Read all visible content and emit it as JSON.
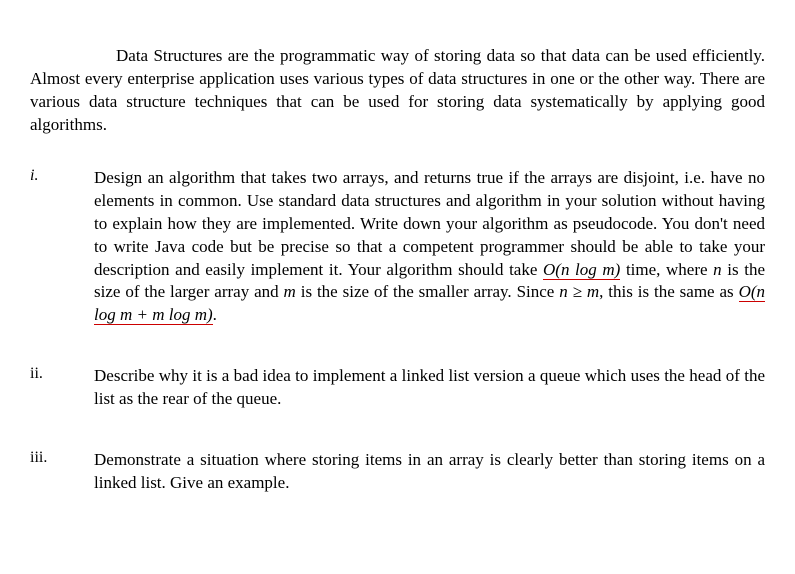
{
  "intro": "Data Structures are the programmatic way of storing data so that data can be used efficiently. Almost every enterprise application uses various types of data structures in one or the other way. There are various data structure techniques that can be used for storing data systematically by applying good algorithms.",
  "items": [
    {
      "marker": "i.",
      "body_pre": "Design an algorithm that takes two arrays, and returns true if the arrays are disjoint, i.e. have no elements in common. Use standard data structures and algorithm in your solution without having to explain how they are implemented. Write down your algorithm as pseudocode. You don't need to write Java code but be precise so that a competent programmer should be able to take your description and easily implement it. Your algorithm should take ",
      "o_n_log_m": "O(n log m)",
      "mid1": " time, where ",
      "n_var": "n",
      "mid2": " is the size of the larger array and ",
      "m_var": "m",
      "mid3": " is the size of the smaller array. Since ",
      "ineq": "n ≥ m",
      "mid4": ", this is the same as ",
      "o_combined": "O(n log m + m log m)",
      "tail": "."
    },
    {
      "marker": "ii.",
      "body": "Describe why it is a bad idea to implement a linked list version a queue which uses the head of the list as the rear of the queue."
    },
    {
      "marker": "iii.",
      "body": "Demonstrate a situation where storing items in an array is clearly better than storing items on a linked list. Give an example."
    }
  ]
}
